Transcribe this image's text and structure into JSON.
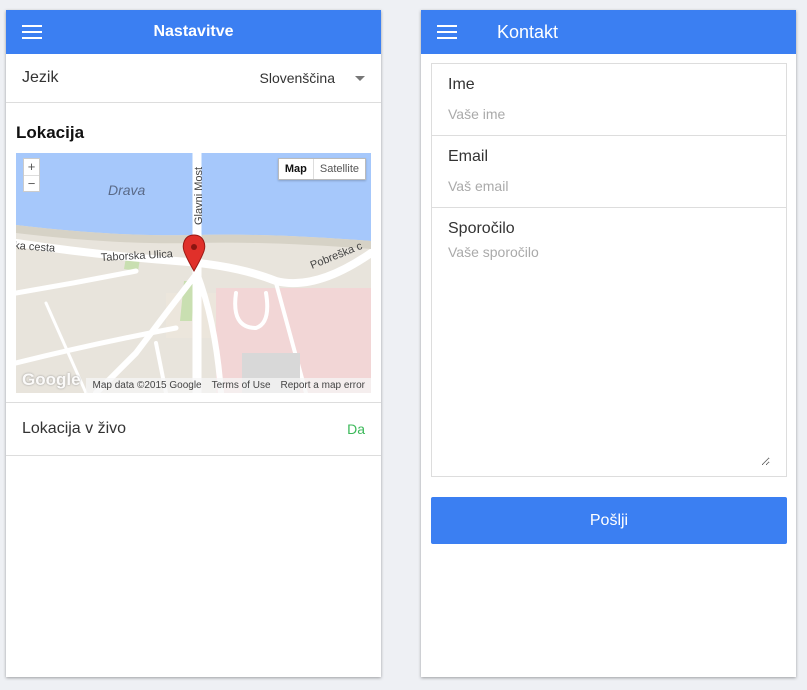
{
  "settings": {
    "title": "Nastavitve",
    "language_label": "Jezik",
    "language_value": "Slovenščina",
    "location_title": "Lokacija",
    "live_location_label": "Lokacija v živo",
    "live_location_value": "Da",
    "map": {
      "zoom_in": "+",
      "zoom_out": "−",
      "type_map": "Map",
      "type_satellite": "Satellite",
      "river_label": "Drava",
      "street_1": "Taborska Ulica",
      "street_2": "ka cesta",
      "street_3": "Glavni Most",
      "street_4": "Pobreška c",
      "google_logo": "Google",
      "attribution_data": "Map data ©2015 Google",
      "attribution_terms": "Terms of Use",
      "attribution_report": "Report a map error"
    }
  },
  "contact": {
    "title": "Kontakt",
    "name_label": "Ime",
    "name_placeholder": "Vaše ime",
    "email_label": "Email",
    "email_placeholder": "Vaš email",
    "message_label": "Sporočilo",
    "message_placeholder": "Vaše sporočilo",
    "send_label": "Pošlji"
  },
  "colors": {
    "appbar": "#3b7ff2",
    "live_value": "#3cb95a",
    "river": "#a6c8fb",
    "marker": "#e0302a"
  }
}
